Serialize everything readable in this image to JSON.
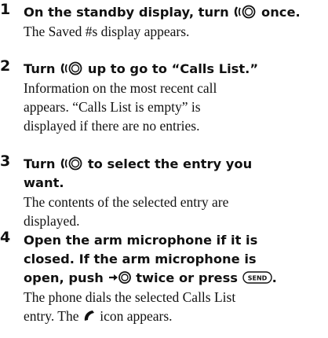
{
  "steps": [
    {
      "number": "1",
      "instruction_a": "On the standby display, turn",
      "instruction_b": "once.",
      "result_1": "The Saved #s display appears.",
      "jog_icon": "jog-dial-icon"
    },
    {
      "number": "2",
      "instruction_a": "Turn",
      "instruction_b": "up to go to “Calls List.”",
      "result_1": "Information on the most recent call",
      "result_2": "appears. “Calls List is empty” is",
      "result_3": "displayed if there are no entries.",
      "jog_icon": "jog-dial-icon"
    },
    {
      "number": "3",
      "instruction_a": "Turn",
      "instruction_b": "to select the entry you",
      "instruction_c": "want.",
      "result_1": "The contents of the selected entry are",
      "result_2": "displayed.",
      "jog_icon": "jog-dial-icon"
    },
    {
      "number": "4",
      "instruction_1": "Open the arm microphone if it is",
      "instruction_2": "closed. If the arm microphone is",
      "instruction_3a": "open, push",
      "instruction_3b": "twice or press",
      "send_key_label": "SEND",
      "result_1": "The phone dials the selected Calls List",
      "result_2a": "entry. The",
      "result_2b": "icon appears.",
      "push_icon": "jog-push-icon",
      "handset_icon": "handset-icon"
    }
  ]
}
